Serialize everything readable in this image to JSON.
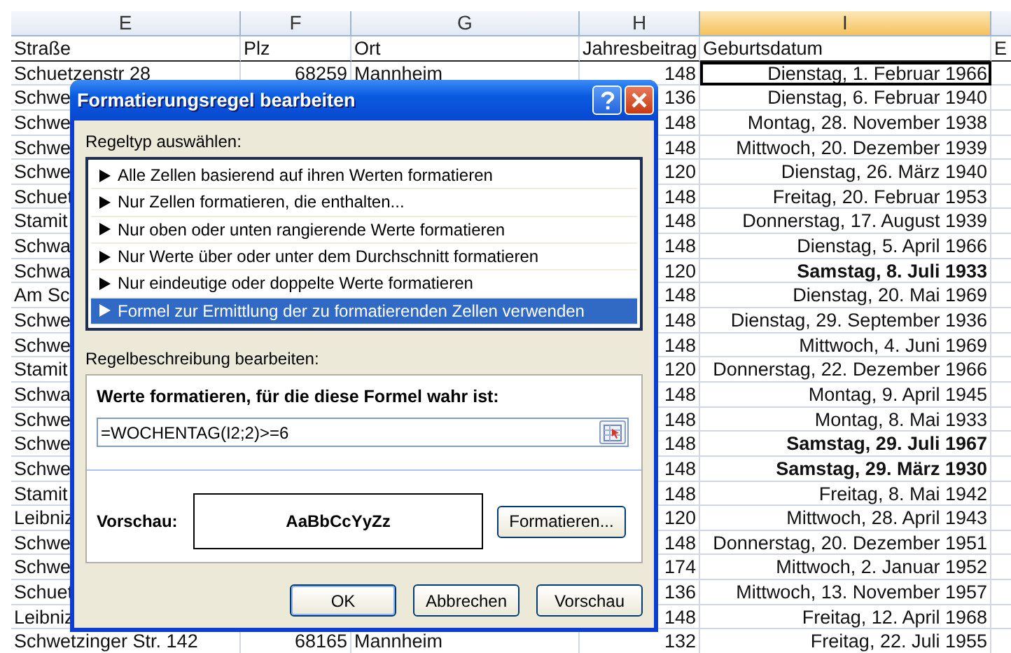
{
  "columns": [
    {
      "label": "E",
      "selected": false
    },
    {
      "label": "F",
      "selected": false
    },
    {
      "label": "G",
      "selected": false
    },
    {
      "label": "H",
      "selected": false
    },
    {
      "label": "I",
      "selected": true
    }
  ],
  "header_row": [
    "Straße",
    "Plz",
    "Ort",
    "Jahresbeitrag",
    "Geburtsdatum",
    "E"
  ],
  "rows": [
    {
      "strasse": "Schuetzenstr 28",
      "plz": "68259",
      "ort": "Mannheim",
      "beitrag": "148",
      "geburtsdatum": "Dienstag, 1. Februar 1966",
      "bold": false,
      "selected": true
    },
    {
      "strasse": "Schwe",
      "beitrag": "136",
      "geburtsdatum": "Dienstag, 6. Februar 1940",
      "bold": false,
      "selected": false
    },
    {
      "strasse": "Schwe",
      "beitrag": "148",
      "geburtsdatum": "Montag, 28. November 1938",
      "bold": false,
      "selected": false
    },
    {
      "strasse": "Schwe",
      "beitrag": "148",
      "geburtsdatum": "Mittwoch, 20. Dezember 1939",
      "bold": false,
      "selected": false
    },
    {
      "strasse": "Schwe",
      "beitrag": "120",
      "geburtsdatum": "Dienstag, 26. März 1940",
      "bold": false,
      "selected": false
    },
    {
      "strasse": "Schuet",
      "beitrag": "148",
      "geburtsdatum": "Freitag, 20. Februar 1953",
      "bold": false,
      "selected": false
    },
    {
      "strasse": "Stamit",
      "beitrag": "148",
      "geburtsdatum": "Donnerstag, 17. August 1939",
      "bold": false,
      "selected": false
    },
    {
      "strasse": "Schwa",
      "beitrag": "148",
      "geburtsdatum": "Dienstag, 5. April 1966",
      "bold": false,
      "selected": false
    },
    {
      "strasse": "Schwa",
      "beitrag": "120",
      "geburtsdatum": "Samstag, 8. Juli 1933",
      "bold": true,
      "selected": false
    },
    {
      "strasse": "Am Sc",
      "beitrag": "148",
      "geburtsdatum": "Dienstag, 20. Mai 1969",
      "bold": false,
      "selected": false
    },
    {
      "strasse": "Schwe",
      "beitrag": "148",
      "geburtsdatum": "Dienstag, 29. September 1936",
      "bold": false,
      "selected": false
    },
    {
      "strasse": "Schwe",
      "beitrag": "148",
      "geburtsdatum": "Mittwoch, 4. Juni 1969",
      "bold": false,
      "selected": false
    },
    {
      "strasse": "Stamit",
      "beitrag": "120",
      "geburtsdatum": "Donnerstag, 22. Dezember 1966",
      "bold": false,
      "selected": false
    },
    {
      "strasse": "Schwa",
      "beitrag": "148",
      "geburtsdatum": "Montag, 9. April 1945",
      "bold": false,
      "selected": false
    },
    {
      "strasse": "Schwe",
      "beitrag": "148",
      "geburtsdatum": "Montag, 8. Mai 1933",
      "bold": false,
      "selected": false
    },
    {
      "strasse": "Schwe",
      "beitrag": "148",
      "geburtsdatum": "Samstag, 29. Juli 1967",
      "bold": true,
      "selected": false
    },
    {
      "strasse": "Schwe",
      "beitrag": "148",
      "geburtsdatum": "Samstag, 29. März 1930",
      "bold": true,
      "selected": false
    },
    {
      "strasse": "Stamit",
      "beitrag": "148",
      "geburtsdatum": "Freitag, 8. Mai 1942",
      "bold": false,
      "selected": false
    },
    {
      "strasse": "Leibniz",
      "beitrag": "120",
      "geburtsdatum": "Mittwoch, 28. April 1943",
      "bold": false,
      "selected": false
    },
    {
      "strasse": "Schwe",
      "beitrag": "148",
      "geburtsdatum": "Donnerstag, 20. Dezember 1951",
      "bold": false,
      "selected": false
    },
    {
      "strasse": "Schwe",
      "beitrag": "174",
      "geburtsdatum": "Mittwoch, 2. Januar 1952",
      "bold": false,
      "selected": false
    },
    {
      "strasse": "Schuet",
      "beitrag": "136",
      "geburtsdatum": "Mittwoch, 13. November 1957",
      "bold": false,
      "selected": false
    },
    {
      "strasse": "Leibniz",
      "beitrag": "148",
      "geburtsdatum": "Freitag, 12. April 1968",
      "bold": false,
      "selected": false
    },
    {
      "strasse": "Schwetzinger Str. 142",
      "plz": "68165",
      "ort": "Mannheim",
      "beitrag": "132",
      "geburtsdatum": "Freitag, 22. Juli 1955",
      "bold": false,
      "selected": false
    }
  ],
  "dialog": {
    "title": "Formatierungsregel bearbeiten",
    "rule_type_label": "Regeltyp auswählen:",
    "rule_types": [
      {
        "label": "Alle Zellen basierend auf ihren Werten formatieren",
        "selected": false
      },
      {
        "label": "Nur Zellen formatieren, die enthalten...",
        "selected": false
      },
      {
        "label": "Nur oben oder unten rangierende Werte formatieren",
        "selected": false
      },
      {
        "label": "Nur Werte über oder unter dem Durchschnitt formatieren",
        "selected": false
      },
      {
        "label": "Nur eindeutige oder doppelte Werte formatieren",
        "selected": false
      },
      {
        "label": "Formel zur Ermittlung der zu formatierenden Zellen verwenden",
        "selected": true
      }
    ],
    "description_label": "Regelbeschreibung bearbeiten:",
    "formula_label": "Werte formatieren, für die diese Formel wahr ist:",
    "formula": {
      "value": "=WOCHENTAG(I2;2)>=6"
    },
    "preview_label": "Vorschau:",
    "preview_sample": "AaBbCcYyZz",
    "format_button": "Formatieren...",
    "buttons": [
      "OK",
      "Abbrechen",
      "Vorschau"
    ]
  }
}
